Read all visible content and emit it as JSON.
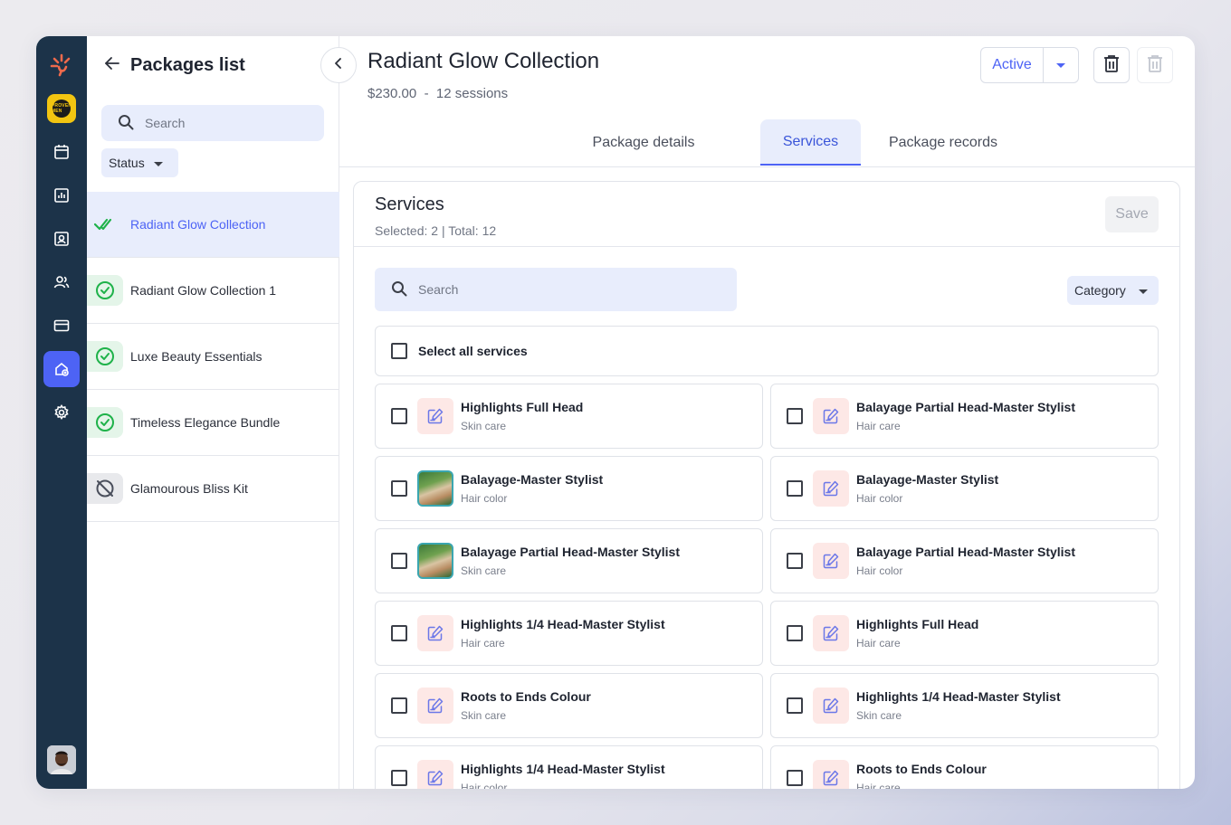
{
  "sidebar_list": {
    "title": "Packages list",
    "search_placeholder": "Search",
    "status_filter": "Status",
    "items": [
      {
        "name": "Radiant Glow Collection",
        "state": "selected-active"
      },
      {
        "name": "Radiant Glow Collection 1",
        "state": "active"
      },
      {
        "name": "Luxe Beauty Essentials",
        "state": "active"
      },
      {
        "name": "Timeless Elegance Bundle",
        "state": "active"
      },
      {
        "name": "Glamourous Bliss Kit",
        "state": "inactive"
      }
    ]
  },
  "brand_badge": "PROVEN MEN",
  "header": {
    "title": "Radiant Glow Collection",
    "price": "$230.00",
    "separator": "-",
    "sessions": "12 sessions",
    "status": "Active"
  },
  "tabs": [
    "Package details",
    "Services",
    "Package records"
  ],
  "active_tab": "Services",
  "services_card": {
    "title": "Services",
    "summary": "Selected: 2 | Total: 12",
    "save_label": "Save",
    "search_placeholder": "Search",
    "category_filter": "Category",
    "select_all_label": "Select all services",
    "items": [
      {
        "name": "Highlights Full Head",
        "category": "Skin care",
        "thumb": "placeholder"
      },
      {
        "name": "Balayage Partial Head-Master Stylist",
        "category": "Hair care",
        "thumb": "placeholder"
      },
      {
        "name": "Balayage-Master Stylist",
        "category": "Hair color",
        "thumb": "photo"
      },
      {
        "name": "Balayage-Master Stylist",
        "category": "Hair color",
        "thumb": "placeholder"
      },
      {
        "name": "Balayage Partial Head-Master Stylist",
        "category": "Skin care",
        "thumb": "photo"
      },
      {
        "name": "Balayage Partial Head-Master Stylist",
        "category": "Hair color",
        "thumb": "placeholder"
      },
      {
        "name": "Highlights 1/4 Head-Master Stylist",
        "category": "Hair care",
        "thumb": "placeholder"
      },
      {
        "name": "Highlights Full Head",
        "category": "Hair care",
        "thumb": "placeholder"
      },
      {
        "name": "Roots to Ends Colour",
        "category": "Skin care",
        "thumb": "placeholder"
      },
      {
        "name": "Highlights 1/4 Head-Master Stylist",
        "category": "Skin care",
        "thumb": "placeholder"
      },
      {
        "name": "Highlights 1/4 Head-Master Stylist",
        "category": "Hair color",
        "thumb": "placeholder"
      },
      {
        "name": "Roots to Ends Colour",
        "category": "Hair care",
        "thumb": "placeholder"
      }
    ]
  },
  "colors": {
    "rail": "#1c3349",
    "accent": "#4d63f5",
    "chip_bg": "#e8edfc",
    "success": "#1fb24a",
    "logo": "#ee6a4c"
  },
  "icons": {
    "rail": [
      "calendar-icon",
      "chart-icon",
      "contact-card-icon",
      "users-icon",
      "credit-card-icon",
      "package-icon",
      "gear-icon"
    ]
  }
}
